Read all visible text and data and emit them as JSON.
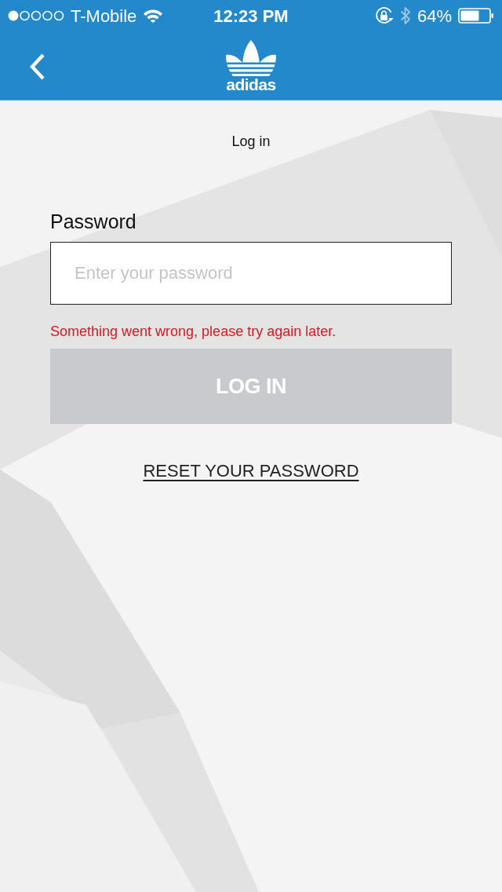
{
  "status_bar": {
    "carrier": "T-Mobile",
    "time": "12:23 PM",
    "battery": "64%"
  },
  "nav_bar": {
    "logo_text": "adidas"
  },
  "page_title": "Log in",
  "form": {
    "password_label": "Password",
    "password_field": {
      "placeholder": "Enter your password"
    },
    "error": "Something went wrong, please try again later.",
    "login_button": {
      "label": "LOG IN",
      "disabled": true
    },
    "reset_link": "RESET YOUR PASSWORD"
  }
}
